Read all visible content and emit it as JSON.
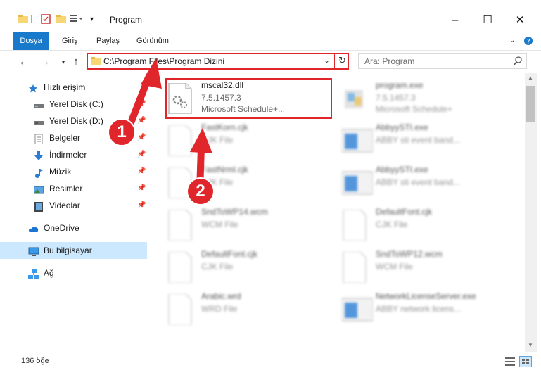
{
  "window": {
    "title": "Program"
  },
  "ribbon": {
    "tabs": [
      "Dosya",
      "Giriş",
      "Paylaş",
      "Görünüm"
    ]
  },
  "address": {
    "path": "C:\\Program Files\\Program Dizini"
  },
  "search": {
    "placeholder": "Ara: Program"
  },
  "nav_pane": {
    "items": [
      {
        "label": "Hızlı erişim",
        "icon": "star-icon"
      },
      {
        "label": "Yerel Disk (C:)",
        "icon": "drive-icon",
        "pinned": true
      },
      {
        "label": "Yerel Disk (D:)",
        "icon": "drive-icon",
        "pinned": true
      },
      {
        "label": "Belgeler",
        "icon": "documents-icon",
        "pinned": true
      },
      {
        "label": "İndirmeler",
        "icon": "download-icon",
        "pinned": true
      },
      {
        "label": "Müzik",
        "icon": "music-icon",
        "pinned": true
      },
      {
        "label": "Resimler",
        "icon": "pictures-icon",
        "pinned": true
      },
      {
        "label": "Videolar",
        "icon": "video-icon",
        "pinned": true
      },
      {
        "label": "OneDrive",
        "icon": "cloud-icon"
      },
      {
        "label": "Bu bilgisayar",
        "icon": "computer-icon"
      },
      {
        "label": "Ağ",
        "icon": "network-icon"
      }
    ]
  },
  "files": [
    {
      "name": "mscal32.dll",
      "line2": "7.5.1457.3",
      "line3": "Microsoft Schedule+...",
      "icon": "dll-icon",
      "highlighted": true
    },
    {
      "name": "program.exe",
      "line2": "7.5.1457.3",
      "line3": "Microsoft Schedule+",
      "icon": "exe-icon"
    },
    {
      "name": "FastKorn.cjk",
      "line2": "CJK File",
      "line3": "",
      "icon": "blank-file-icon"
    },
    {
      "name": "AbbyySTI.exe",
      "line2": "ABBY sti event band...",
      "line3": "",
      "icon": "app-window-icon"
    },
    {
      "name": "FastNrml.cjk",
      "line2": "CJK File",
      "line3": "",
      "icon": "blank-file-icon"
    },
    {
      "name": "AbbyySTI.exe",
      "line2": "ABBY sti event band...",
      "line3": "",
      "icon": "app-window-icon"
    },
    {
      "name": "SndToWP14.wcm",
      "line2": "WCM File",
      "line3": "",
      "icon": "blank-file-icon"
    },
    {
      "name": "DefaultFont.cjk",
      "line2": "CJK File",
      "line3": "",
      "icon": "blank-file-icon"
    },
    {
      "name": "DefaultFont.cjk",
      "line2": "CJK File",
      "line3": "",
      "icon": "blank-file-icon"
    },
    {
      "name": "SndToWP12.wcm",
      "line2": "WCM File",
      "line3": "",
      "icon": "blank-file-icon"
    },
    {
      "name": "Arabic.wrd",
      "line2": "WRD File",
      "line3": "",
      "icon": "blank-file-icon"
    },
    {
      "name": "NetworkLicenseServer.exe",
      "line2": "ABBY network licens...",
      "line3": "",
      "icon": "app-window-icon"
    }
  ],
  "annotations": {
    "step1": "1",
    "step2": "2"
  },
  "status": {
    "count": "136 öğe"
  },
  "colors": {
    "accent": "#1979ca",
    "highlight": "#e0262a",
    "selected": "#cce8ff"
  }
}
